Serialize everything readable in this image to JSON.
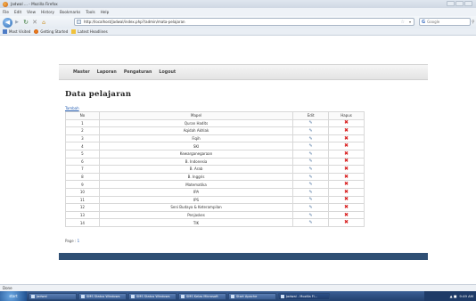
{
  "window": {
    "title": "Jadwal ... - Mozilla Firefox"
  },
  "menubar": [
    "File",
    "Edit",
    "View",
    "History",
    "Bookmarks",
    "Tools",
    "Help"
  ],
  "navbar": {
    "url": "http://localhost/jadwal/index.php?/admin/mata-pelajaran",
    "search_placeholder": "Google"
  },
  "bookmarks": [
    {
      "label": "Most Visited",
      "icon": "most-visited-icon"
    },
    {
      "label": "Getting Started",
      "icon": "getting-started-icon"
    },
    {
      "label": "Latest Headlines",
      "icon": "rss-icon"
    }
  ],
  "site_menu": [
    "Master",
    "Laporan",
    "Pengaturan",
    "Logout"
  ],
  "page": {
    "heading": "Data pelajaran",
    "add_link": "Tambah"
  },
  "table": {
    "headers": [
      "No",
      "Mapel",
      "Edit",
      "Hapus"
    ],
    "rows": [
      {
        "no": "1",
        "mapel": "Quran Hadits"
      },
      {
        "no": "2",
        "mapel": "Aqidah Akhlak"
      },
      {
        "no": "3",
        "mapel": "Fiqih"
      },
      {
        "no": "4",
        "mapel": "SKI"
      },
      {
        "no": "5",
        "mapel": "Kewarganegaraan"
      },
      {
        "no": "6",
        "mapel": "B. Indonesia"
      },
      {
        "no": "7",
        "mapel": "B. Arab"
      },
      {
        "no": "8",
        "mapel": "B. Inggris"
      },
      {
        "no": "9",
        "mapel": "Matematika"
      },
      {
        "no": "10",
        "mapel": "IPA"
      },
      {
        "no": "11",
        "mapel": "IPS"
      },
      {
        "no": "12",
        "mapel": "Seni Budaya & Keterampilan"
      },
      {
        "no": "13",
        "mapel": "Penjaskes"
      },
      {
        "no": "14",
        "mapel": "TIK"
      }
    ]
  },
  "pager": {
    "label": "Page :",
    "current": "1"
  },
  "statusbar": {
    "text": "Done"
  },
  "taskbar": {
    "start": "start",
    "tasks": [
      "Jadwal",
      "SMS Status Windows",
      "SMS Status Windows",
      "SMS Kelas Microsoft",
      "Start Apache",
      "Jadwal - Mozilla Fi..."
    ],
    "clock": "9:49 AM"
  }
}
